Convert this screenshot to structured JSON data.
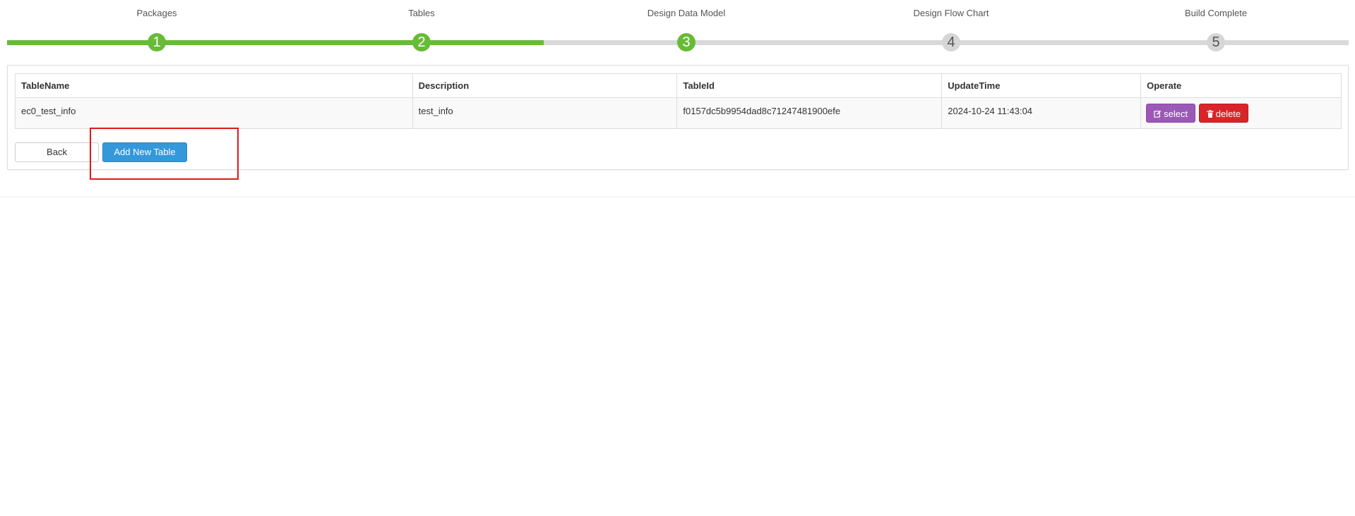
{
  "wizard": {
    "steps": [
      {
        "label": "Packages",
        "number": "1",
        "status": "done"
      },
      {
        "label": "Tables",
        "number": "2",
        "status": "done"
      },
      {
        "label": "Design Data Model",
        "number": "3",
        "status": "current"
      },
      {
        "label": "Design Flow Chart",
        "number": "4",
        "status": "todo"
      },
      {
        "label": "Build Complete",
        "number": "5",
        "status": "todo"
      }
    ],
    "progress_fraction": 0.4,
    "active_color": "#67bb36",
    "inactive_color": "#d9d9d9"
  },
  "table": {
    "columns": [
      "TableName",
      "Description",
      "TableId",
      "UpdateTime",
      "Operate"
    ],
    "rows": [
      {
        "table_name": "ec0_test_info",
        "description": "test_info",
        "table_id": "f0157dc5b9954dad8c71247481900efe",
        "update_time": "2024-10-24 11:43:04",
        "select_label": "select",
        "delete_label": "delete"
      }
    ]
  },
  "buttons": {
    "back_label": "Back",
    "add_label": "Add New Table"
  },
  "icons": {
    "select": "edit-icon",
    "delete": "trash-icon"
  },
  "colors": {
    "select_button": "#9b59b6",
    "delete_button": "#d9252a",
    "primary_button": "#3498db",
    "highlight_box": "#e01818"
  }
}
